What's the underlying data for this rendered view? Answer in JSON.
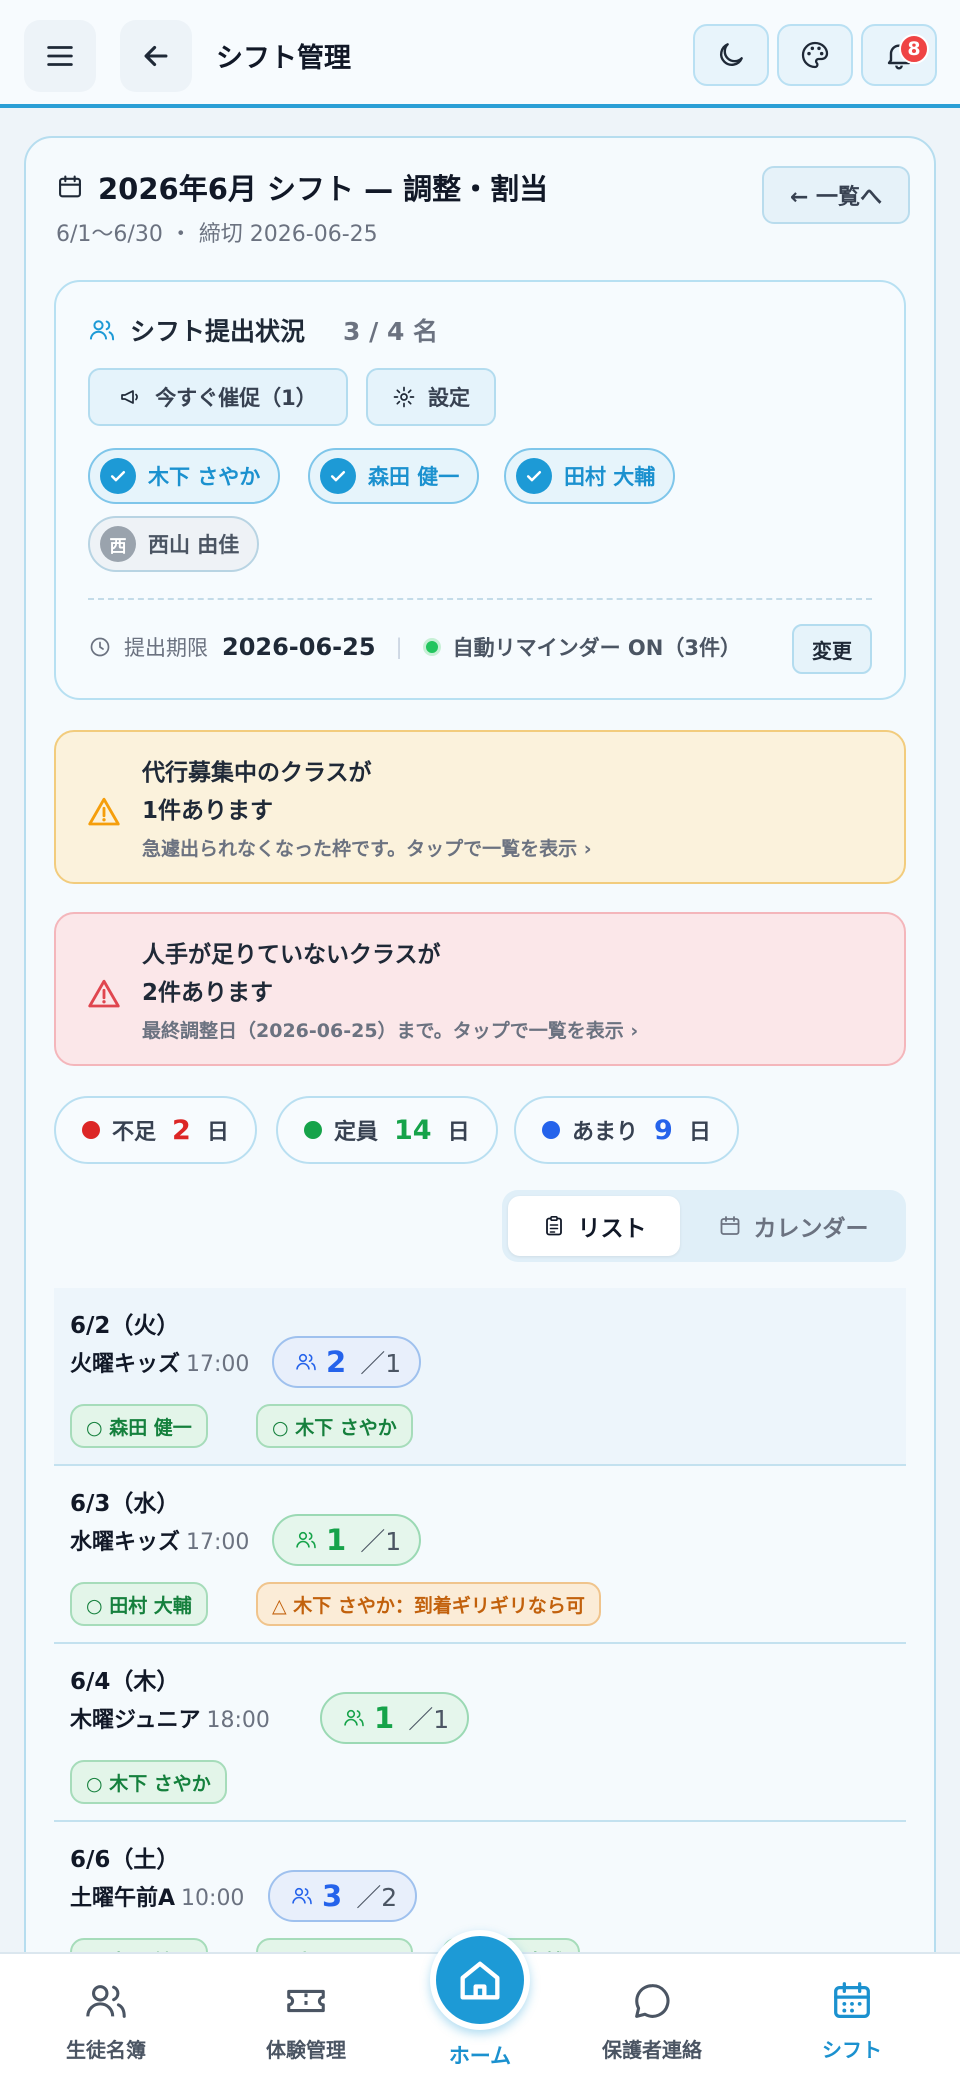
{
  "header": {
    "title": "シフト管理",
    "notification_count": "8"
  },
  "page": {
    "title": "2026年6月 シフト — 調整・割当",
    "subtitle": "6/1〜6/30 ・ 締切 2026-06-25",
    "back_to_list": "← 一覧へ"
  },
  "submission": {
    "title": "シフト提出状況",
    "count": "3 / 4 名",
    "remind_button": "今すぐ催促（1）",
    "settings_button": "設定",
    "submitted": [
      "木下 さやか",
      "森田 健一",
      "田村 大輔"
    ],
    "pending": [
      {
        "initial": "西",
        "name": "西山 由佳"
      }
    ],
    "deadline_label": "提出期限",
    "deadline_value": "2026-06-25",
    "reminder_text": "自動リマインダー ON（3件）",
    "change_button": "変更"
  },
  "alerts": {
    "substitute": {
      "line1": "代行募集中のクラスが",
      "line2": "1件あります",
      "sub": "急遽出られなくなった枠です。タップで一覧を表示 ›"
    },
    "shortage": {
      "line1": "人手が足りていないクラスが",
      "line2": "2件あります",
      "sub": "最終調整日（2026-06-25）まで。タップで一覧を表示 ›"
    }
  },
  "summary": {
    "short": {
      "label": "不足",
      "value": "2",
      "unit": "日",
      "color": "#dc2626"
    },
    "full": {
      "label": "定員",
      "value": "14",
      "unit": "日",
      "color": "#16a34a"
    },
    "extra": {
      "label": "あまり",
      "value": "9",
      "unit": "日",
      "color": "#2563eb"
    }
  },
  "view_toggle": {
    "list": "リスト",
    "calendar": "カレンダー"
  },
  "shifts": [
    {
      "date": "6/2（火）",
      "class_name": "火曜キッズ",
      "time": "17:00",
      "assigned": "2",
      "capacity": "／1",
      "status": "over",
      "tags": [
        {
          "text": "○ 森田 健一",
          "kind": "ok"
        },
        {
          "text": "○ 木下 さやか",
          "kind": "ok"
        }
      ]
    },
    {
      "date": "6/3（水）",
      "class_name": "水曜キッズ",
      "time": "17:00",
      "assigned": "1",
      "capacity": "／1",
      "status": "ok",
      "tags": [
        {
          "text": "○ 田村 大輔",
          "kind": "ok"
        },
        {
          "text": "△ 木下 さやか：到着ギリギリなら可",
          "kind": "maybe"
        }
      ]
    },
    {
      "date": "6/4（木）",
      "class_name": "木曜ジュニア",
      "time": "18:00",
      "assigned": "1",
      "capacity": "／1",
      "status": "ok",
      "tags": [
        {
          "text": "○ 木下 さやか",
          "kind": "ok"
        }
      ]
    },
    {
      "date": "6/6（土）",
      "class_name": "土曜午前A",
      "time": "10:00",
      "assigned": "3",
      "capacity": "／2",
      "status": "over",
      "tags": [
        {
          "text": "○ 森田 健一",
          "kind": "ok"
        },
        {
          "text": "○ 木下 さやか",
          "kind": "ok"
        },
        {
          "text": "○ 田村 大輔",
          "kind": "ok"
        }
      ]
    }
  ],
  "bottom_nav": {
    "students": "生徒名簿",
    "trial": "体験管理",
    "home": "ホーム",
    "parents": "保護者連絡",
    "shift": "シフト"
  },
  "colors": {
    "accent": "#1d9ad6",
    "over": "#2563eb",
    "ok": "#16a34a",
    "short": "#dc2626",
    "warning": "#f59e0b"
  }
}
